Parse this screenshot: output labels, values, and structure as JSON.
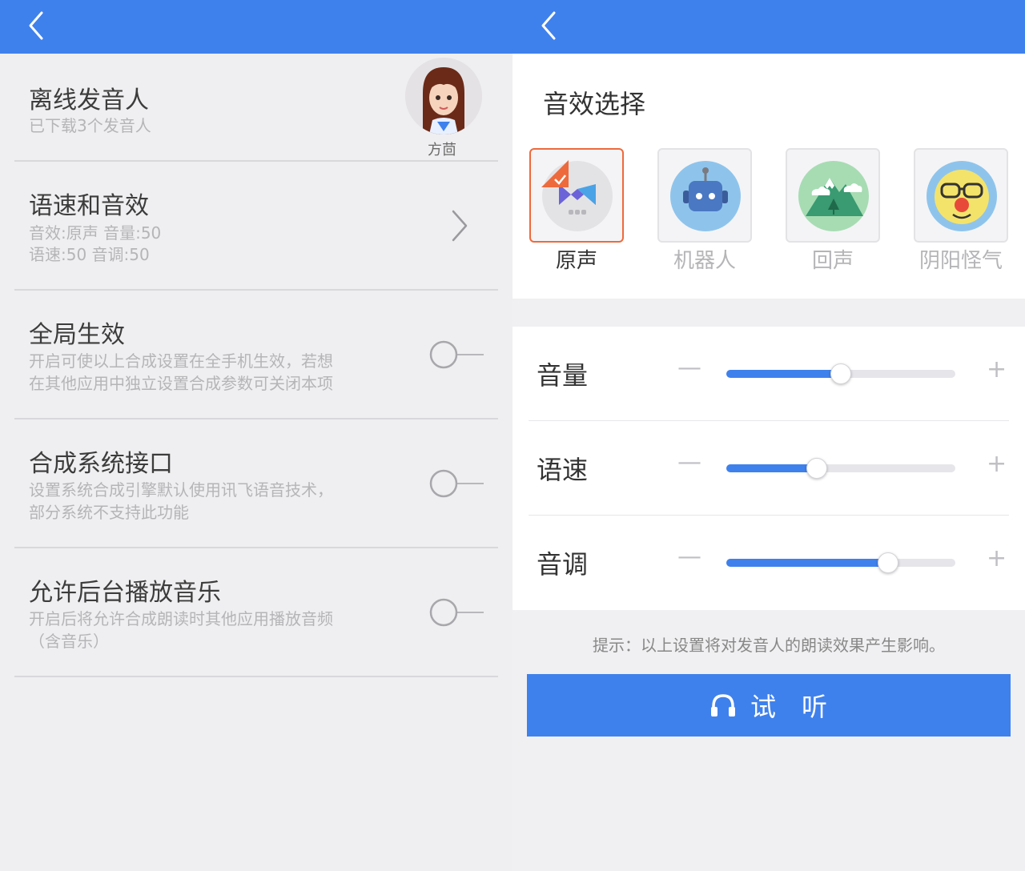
{
  "left": {
    "items": [
      {
        "title": "离线发音人",
        "desc1": "已下载3个发音人",
        "avatar_label": "方茴"
      },
      {
        "title": "语速和音效",
        "desc1": "音效:原声 音量:50",
        "desc2": "语速:50 音调:50"
      },
      {
        "title": "全局生效",
        "desc1": "开启可使以上合成设置在全手机生效，若想",
        "desc2": "在其他应用中独立设置合成参数可关闭本项",
        "toggle_on": false
      },
      {
        "title": "合成系统接口",
        "desc1": "设置系统合成引擎默认使用讯飞语音技术，",
        "desc2": "部分系统不支持此功能",
        "toggle_on": false
      },
      {
        "title": "允许后台播放音乐",
        "desc1": "开启后将允许合成朗读时其他应用播放音频",
        "desc2": "（含音乐）",
        "toggle_on": false
      }
    ]
  },
  "right": {
    "section_title": "音效选择",
    "effects": [
      {
        "name": "原声",
        "icon": "original-voice-icon",
        "selected": true
      },
      {
        "name": "机器人",
        "icon": "robot-icon",
        "selected": false
      },
      {
        "name": "回声",
        "icon": "echo-mountain-icon",
        "selected": false
      },
      {
        "name": "阴阳怪气",
        "icon": "clown-icon",
        "selected": false
      }
    ],
    "sliders": [
      {
        "label": "音量",
        "value_fraction": 0.5,
        "minus": "—",
        "plus": "+"
      },
      {
        "label": "语速",
        "value_fraction": 0.395,
        "minus": "—",
        "plus": "+"
      },
      {
        "label": "音调",
        "value_fraction": 0.705,
        "minus": "—",
        "plus": "+"
      }
    ],
    "hint": "提示：以上设置将对发音人的朗读效果产生影响。",
    "listen_label": "试　听"
  },
  "colors": {
    "accent": "#3f81ec",
    "selected_border": "#ee6a3c",
    "muted_text": "#b5b5b8"
  }
}
